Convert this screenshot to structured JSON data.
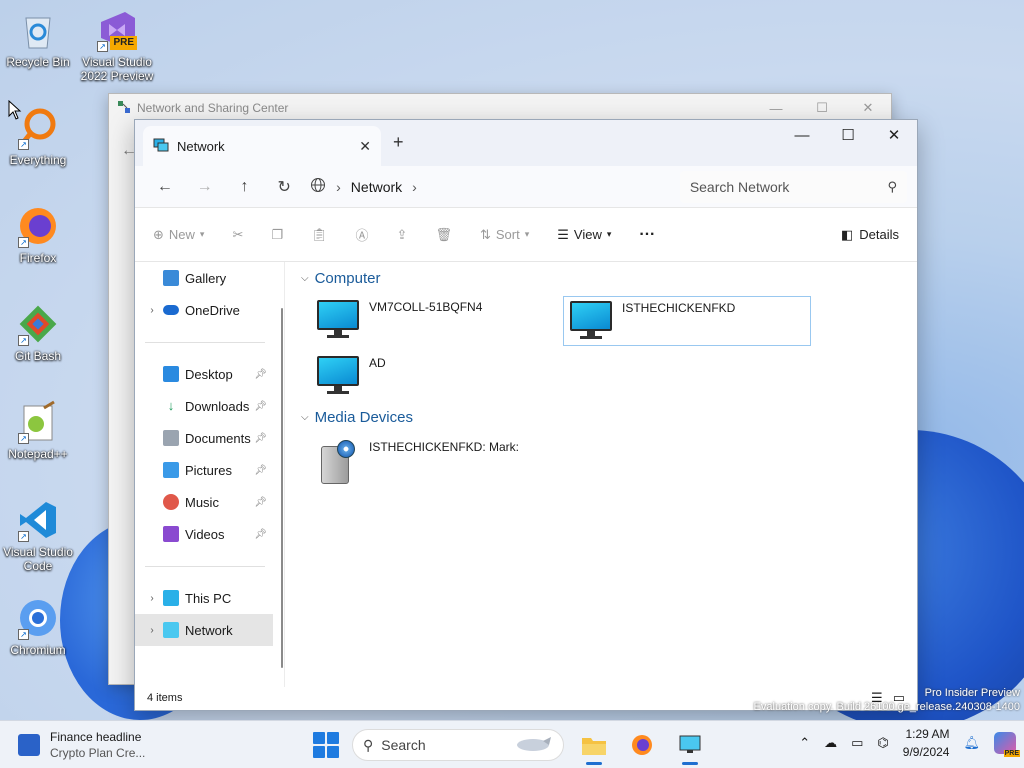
{
  "desktop": {
    "icons": [
      {
        "label": "Recycle Bin",
        "icon": "recycle-bin-icon"
      },
      {
        "label": "Visual Studio 2022 Preview",
        "icon": "visual-studio-preview-icon",
        "badge": "PRE"
      },
      {
        "label": "Everything",
        "icon": "everything-search-icon"
      },
      {
        "label": "Firefox",
        "icon": "firefox-icon"
      },
      {
        "label": "Git Bash",
        "icon": "git-bash-icon"
      },
      {
        "label": "Notepad++",
        "icon": "notepad-plus-plus-icon"
      },
      {
        "label": "Visual Studio Code",
        "icon": "vscode-icon"
      },
      {
        "label": "Chromium",
        "icon": "chromium-icon"
      }
    ],
    "watermark": [
      "Pro Insider Preview",
      "Evaluation copy. Build 26100.ge_release.240308-1400"
    ]
  },
  "back_window": {
    "title": "Network and Sharing Center"
  },
  "explorer": {
    "tab_title": "Network",
    "address": {
      "location": "Network"
    },
    "search": {
      "placeholder": "Search Network"
    },
    "commands": {
      "new": "New",
      "sort": "Sort",
      "view": "View",
      "more": "···",
      "details": "Details"
    },
    "nav": {
      "gallery": "Gallery",
      "onedrive": "OneDrive",
      "quick": [
        "Desktop",
        "Downloads",
        "Documents",
        "Pictures",
        "Music",
        "Videos"
      ],
      "this_pc": "This PC",
      "network": "Network"
    },
    "groups": {
      "computer": {
        "title": "Computer",
        "items": [
          "VM7COLL-51BQFN4",
          "ISTHECHICKENFKD",
          "AD"
        ]
      },
      "media": {
        "title": "Media Devices",
        "items": [
          "ISTHECHICKENFKD: Mark:"
        ]
      }
    },
    "status": {
      "items_count": "4 items"
    }
  },
  "taskbar": {
    "widget": {
      "title": "Finance headline",
      "subtitle": "Crypto Plan Cre..."
    },
    "search_label": "Search",
    "clock": {
      "time": "1:29 AM",
      "date": "9/9/2024"
    },
    "tray_badge": "PRE"
  },
  "colors": {
    "accent": "#1e6fd0",
    "group_heading": "#1a5b9a",
    "selection_border": "#99c8f0"
  }
}
